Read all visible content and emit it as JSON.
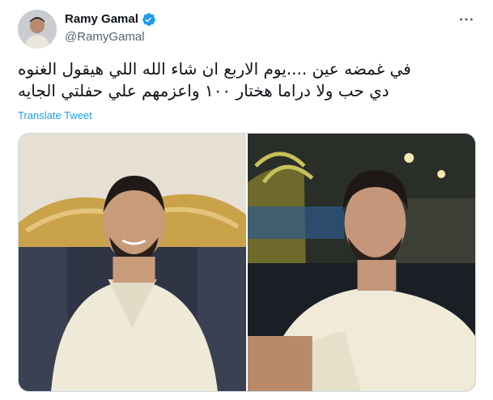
{
  "author": {
    "name": "Ramy Gamal",
    "handle": "@RamyGamal",
    "verified": true
  },
  "tweet": {
    "text": "في غمضه عين ....يوم الاربع ان شاء الله اللي هيقول الغنوه\nدي حب ولا دراما هختار ١٠٠ واعزمهم علي حفلتي الجايه",
    "translate_label": "Translate Tweet"
  },
  "media": {
    "count": 2
  },
  "colors": {
    "link": "#1d9bf0",
    "verified": "#1d9bf0",
    "secondary_text": "#536471"
  },
  "icons": [
    "verified-badge-icon",
    "more-options-icon"
  ]
}
